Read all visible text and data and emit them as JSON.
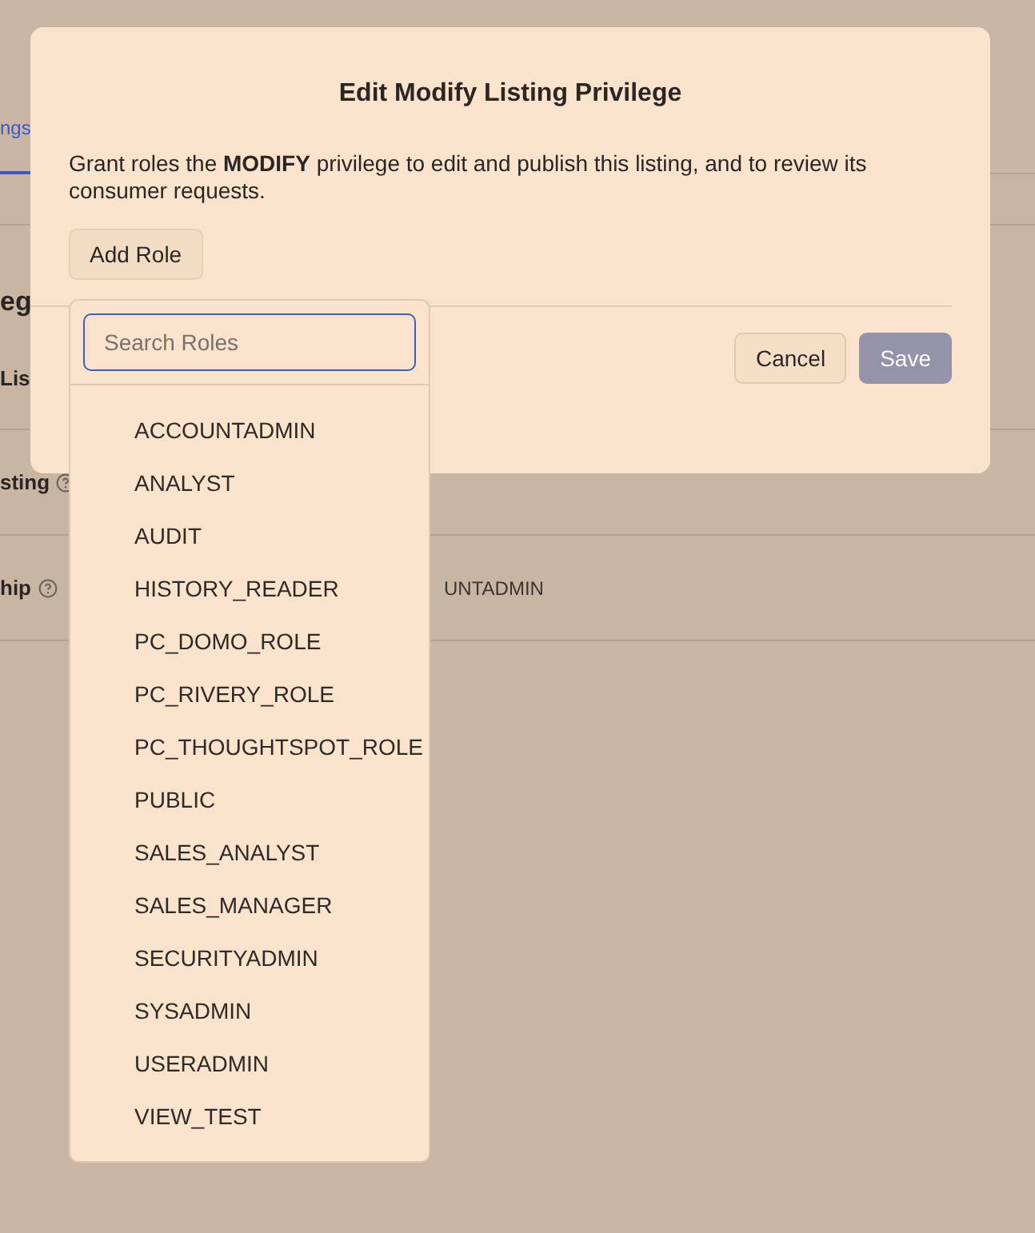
{
  "background_page": {
    "tab": {
      "label": "ngs",
      "selected": true
    },
    "heading": "eg",
    "rows": [
      {
        "label": "Lis",
        "help": false
      },
      {
        "label": "sting",
        "help": true
      },
      {
        "label": "hip",
        "help": true,
        "value": "UNTADMIN"
      }
    ]
  },
  "dialog": {
    "title": "Edit Modify Listing Privilege",
    "description": "Grant roles the **MODIFY** privilege to edit and publish this listing, and to review its consumer requests.",
    "add_button": "Add Role",
    "buttons": [
      {
        "label": "Cancel",
        "disabled": false
      },
      {
        "label": "Save",
        "disabled": true
      }
    ]
  },
  "role_dropdown": {
    "search": {
      "placeholder": "Search Roles"
    },
    "roles": [
      "ACCOUNTADMIN",
      "ANALYST",
      "AUDIT",
      "HISTORY_READER",
      "PC_DOMO_ROLE",
      "PC_RIVERY_ROLE",
      "PC_THOUGHTSPOT_ROLE",
      "PUBLIC",
      "SALES_ANALYST",
      "SALES_MANAGER",
      "SECURITYADMIN",
      "SYSADMIN",
      "USERADMIN",
      "VIEW_TEST"
    ]
  }
}
